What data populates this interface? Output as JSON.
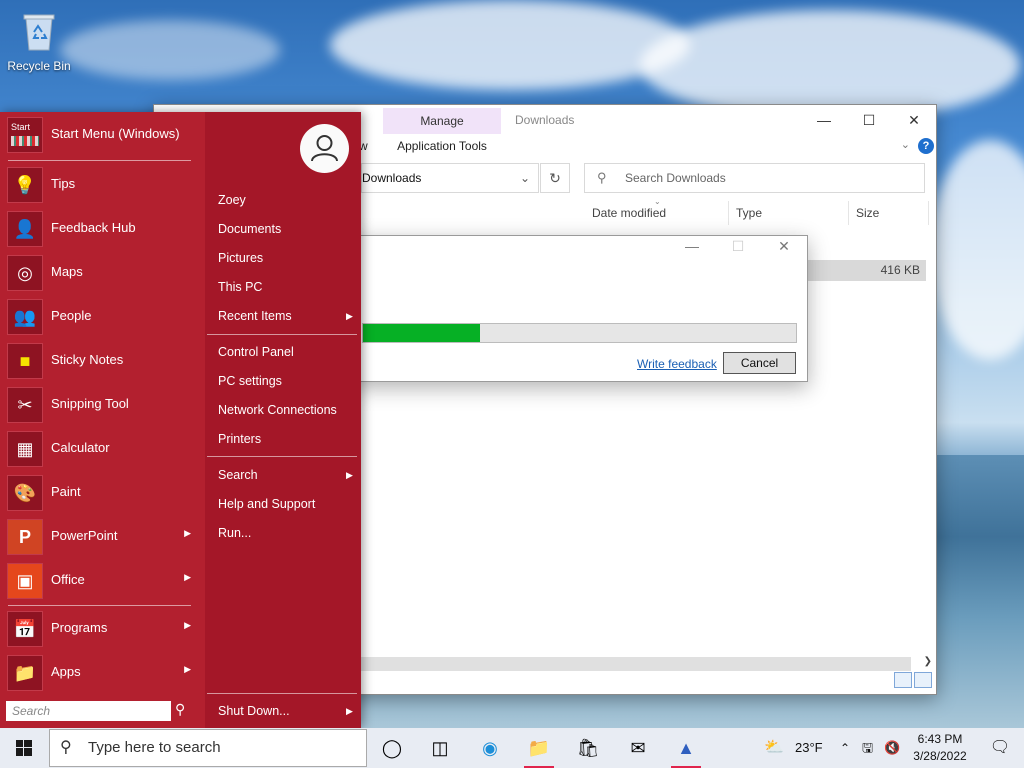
{
  "desktop": {
    "recycle_bin_label": "Recycle Bin"
  },
  "explorer": {
    "context_tab": "Manage",
    "ribbon_tab": "Application Tools",
    "title": "Downloads",
    "partial_tab_text": "w",
    "address": "Downloads",
    "search_placeholder": "Search Downloads",
    "columns": {
      "date_modified": "Date modified",
      "type": "Type",
      "size": "Size"
    },
    "selected_row_size": "416 KB"
  },
  "dialog": {
    "progress_percent": 27,
    "feedback_link": "Write feedback",
    "cancel_label": "Cancel"
  },
  "start_menu": {
    "header_label": "Start Menu (Windows)",
    "header_tile_text": "Start",
    "apps": [
      {
        "label": "Tips",
        "icon": "lightbulb-icon",
        "has_arrow": false
      },
      {
        "label": "Feedback Hub",
        "icon": "feedback-icon",
        "has_arrow": false
      },
      {
        "label": "Maps",
        "icon": "maps-icon",
        "has_arrow": false
      },
      {
        "label": "People",
        "icon": "people-icon",
        "has_arrow": false
      },
      {
        "label": "Sticky Notes",
        "icon": "sticky-note-icon",
        "has_arrow": false
      },
      {
        "label": "Snipping Tool",
        "icon": "scissors-icon",
        "has_arrow": false
      },
      {
        "label": "Calculator",
        "icon": "calculator-icon",
        "has_arrow": false
      },
      {
        "label": "Paint",
        "icon": "palette-icon",
        "has_arrow": false
      },
      {
        "label": "PowerPoint",
        "icon": "powerpoint-icon",
        "has_arrow": true
      },
      {
        "label": "Office",
        "icon": "office-icon",
        "has_arrow": true
      }
    ],
    "programs_label": "Programs",
    "apps_label": "Apps",
    "search_placeholder": "Search",
    "user_items": [
      "Zoey",
      "Documents",
      "Pictures",
      "This PC",
      "Recent Items"
    ],
    "system_items": [
      "Control Panel",
      "PC settings",
      "Network Connections",
      "Printers"
    ],
    "help_items": [
      "Search",
      "Help and Support",
      "Run..."
    ],
    "shutdown_label": "Shut Down..."
  },
  "taskbar": {
    "search_placeholder": "Type here to search",
    "weather_temp": "23°F",
    "time": "6:43 PM",
    "date": "3/28/2022"
  },
  "colors": {
    "start_menu_bg": "#b01c2e",
    "progress_fill": "#06b025",
    "link": "#1a5fb4",
    "taskbar_active": "#e0244c"
  }
}
